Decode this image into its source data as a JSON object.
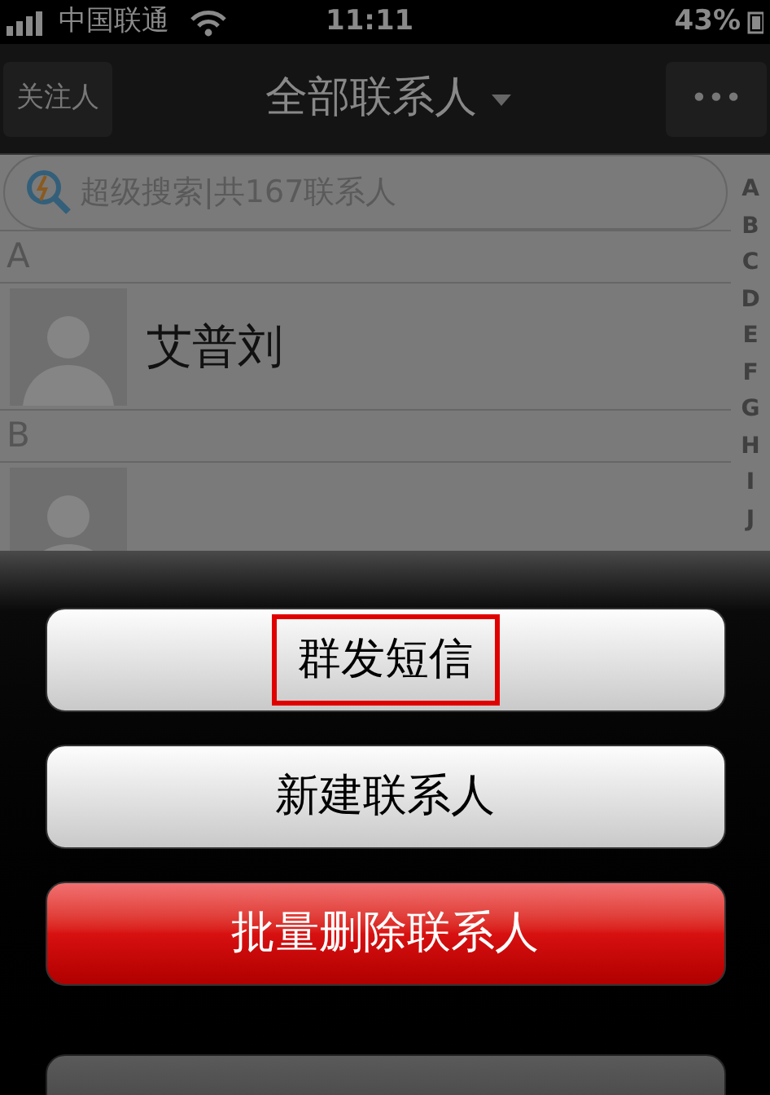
{
  "status_bar": {
    "carrier": "中国联通",
    "time": "11:11",
    "battery": "43%"
  },
  "nav": {
    "left_button": "关注人",
    "title": "全部联系人",
    "more": "•••"
  },
  "search": {
    "placeholder": "超级搜索|共167联系人"
  },
  "index": [
    "A",
    "B",
    "C",
    "D",
    "E",
    "F",
    "G",
    "H",
    "I",
    "J"
  ],
  "sections": [
    {
      "letter": "A",
      "contacts": [
        {
          "kind": "contact",
          "name": "艾普刘"
        }
      ]
    },
    {
      "letter": "B",
      "contacts": [
        {
          "kind": "contact"
        }
      ]
    }
  ],
  "actions": [
    {
      "label": "群发短信",
      "kind": "normal",
      "highlighted": true
    },
    {
      "label": "新建联系人",
      "kind": "normal",
      "highlighted": false
    },
    {
      "label": "批量删除联系人",
      "kind": "danger",
      "highlighted": false
    },
    {
      "kind": "cancel"
    }
  ]
}
